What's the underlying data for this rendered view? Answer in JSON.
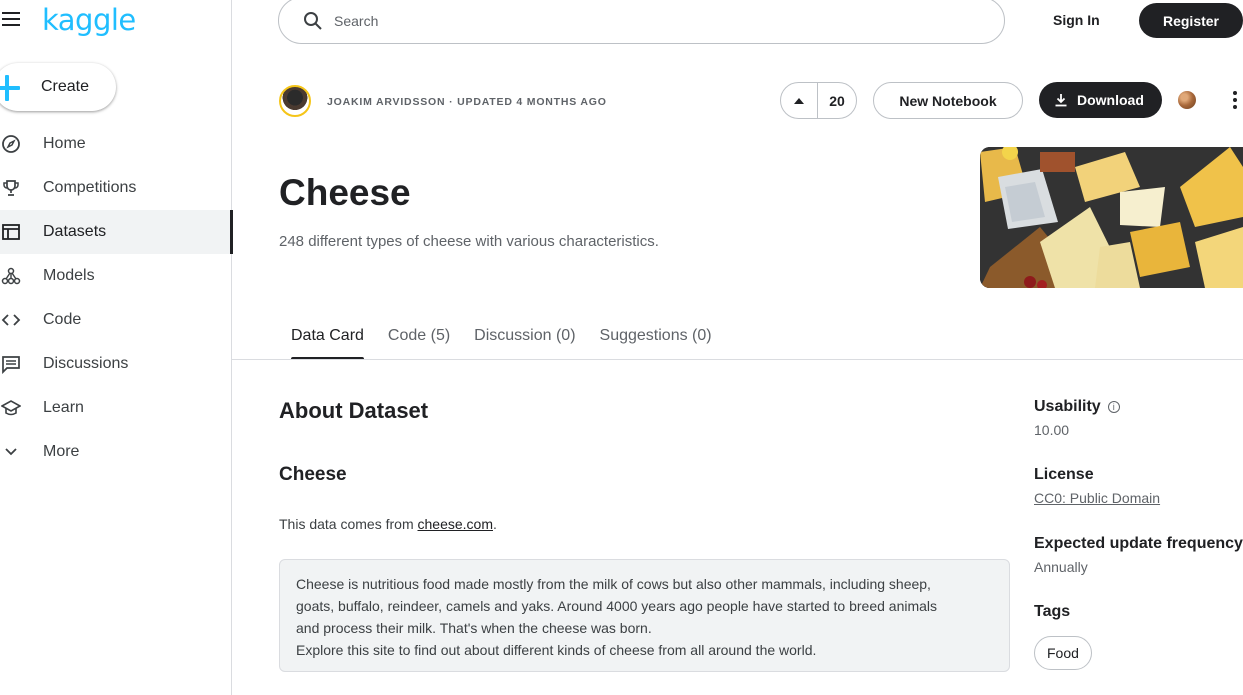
{
  "brand": {
    "logo_text": "kaggle",
    "accent": "#20beff"
  },
  "sidebar": {
    "create_label": "Create",
    "items": [
      {
        "label": "Home",
        "icon": "compass-icon"
      },
      {
        "label": "Competitions",
        "icon": "trophy-icon"
      },
      {
        "label": "Datasets",
        "icon": "table-icon",
        "active": true
      },
      {
        "label": "Models",
        "icon": "models-icon"
      },
      {
        "label": "Code",
        "icon": "code-icon"
      },
      {
        "label": "Discussions",
        "icon": "comments-icon"
      },
      {
        "label": "Learn",
        "icon": "graduation-cap-icon"
      },
      {
        "label": "More",
        "icon": "chevron-down-icon"
      }
    ]
  },
  "header": {
    "search_placeholder": "Search",
    "sign_in": "Sign In",
    "register": "Register"
  },
  "dataset": {
    "byline": "JOAKIM ARVIDSSON · UPDATED 4 MONTHS AGO",
    "upvotes": "20",
    "new_notebook": "New Notebook",
    "download": "Download",
    "title": "Cheese",
    "subtitle": "248 different types of cheese with various characteristics."
  },
  "tabs": [
    {
      "label": "Data Card",
      "active": true
    },
    {
      "label": "Code (5)"
    },
    {
      "label": "Discussion (0)"
    },
    {
      "label": "Suggestions (0)"
    }
  ],
  "content": {
    "about_heading": "About Dataset",
    "section_heading": "Cheese",
    "source_prefix": "This data comes from ",
    "source_link": "cheese.com",
    "source_suffix": ".",
    "quote_lines": [
      "Cheese is nutritious food made mostly from the milk of cows but also other mammals, including sheep,",
      "goats, buffalo, reindeer, camels and yaks. Around 4000 years ago people have started to breed animals",
      "and process their milk. That's when the cheese was born.",
      "Explore this site to find out about different kinds of cheese from all around the world."
    ]
  },
  "meta": {
    "usability_label": "Usability",
    "usability_value": "10.00",
    "license_label": "License",
    "license_value": "CC0: Public Domain",
    "frequency_label": "Expected update frequency",
    "frequency_value": "Annually",
    "tags_label": "Tags",
    "tags": [
      "Food"
    ]
  }
}
